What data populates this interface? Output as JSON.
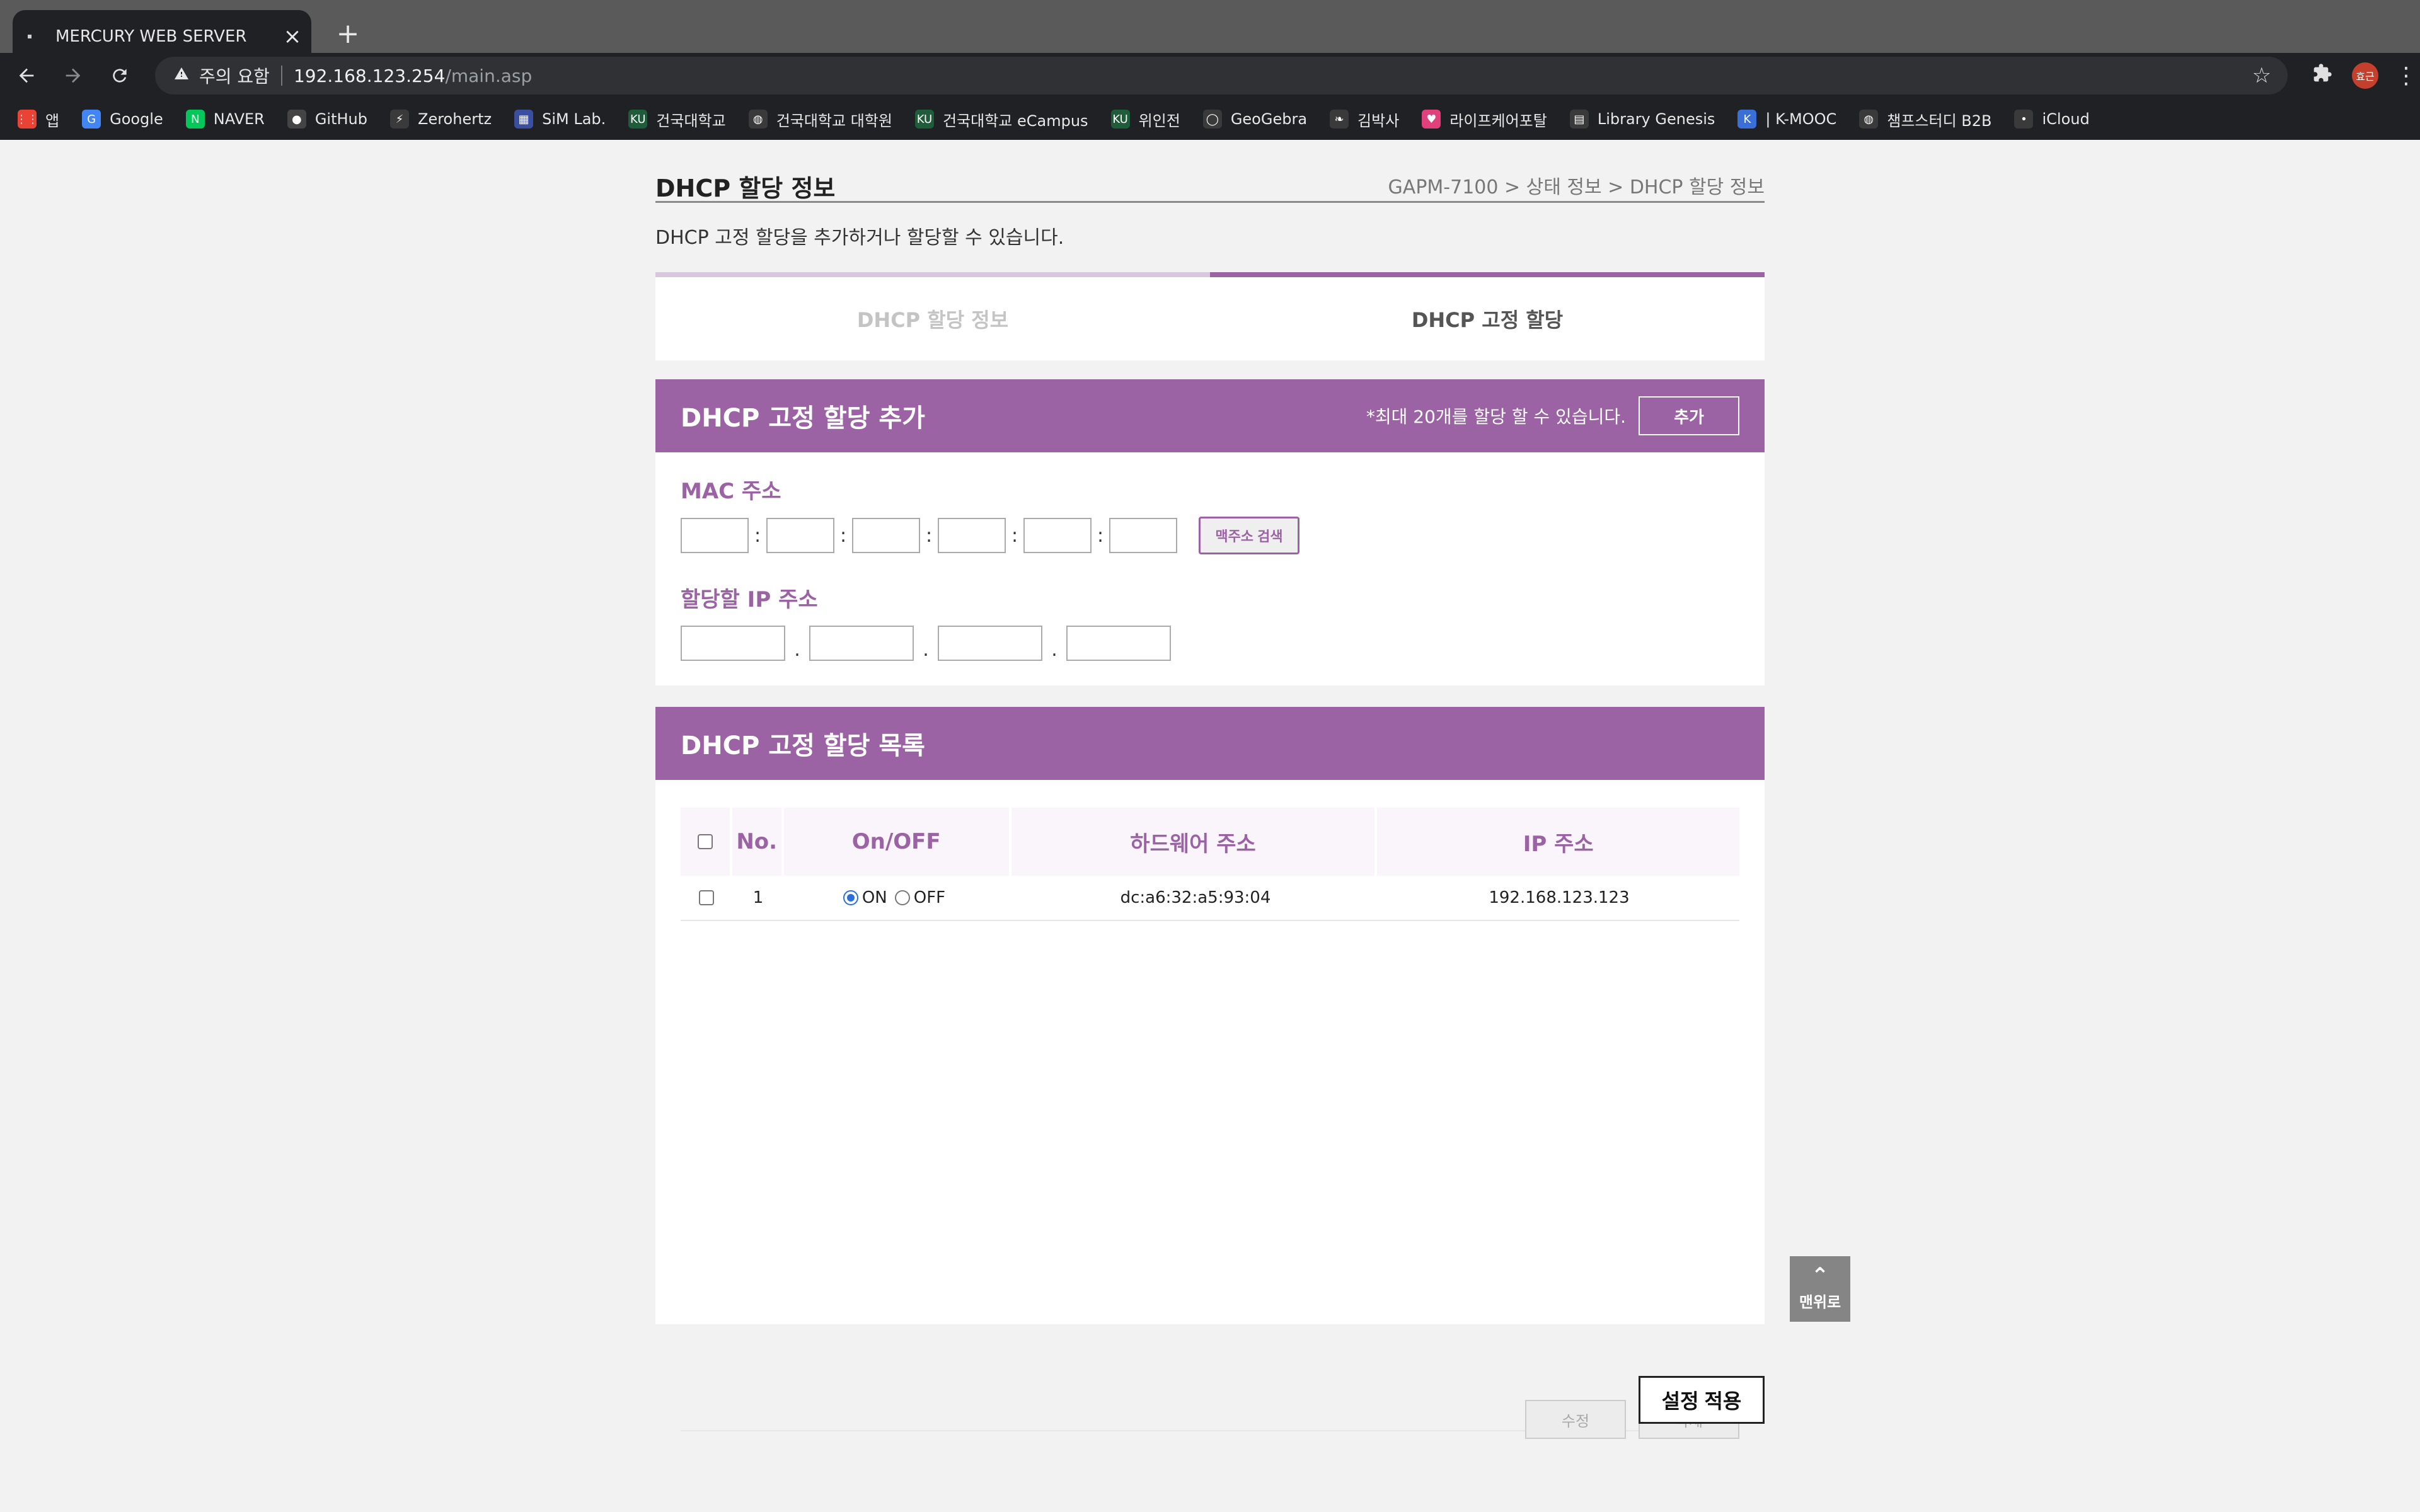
{
  "browser": {
    "tab_title": "MERCURY WEB SERVER",
    "tab_close": "×",
    "new_tab": "+",
    "security_label": "주의 요함",
    "url_host": "192.168.123.254",
    "url_path": "/main.asp",
    "avatar_text": "효근",
    "bookmarks": [
      {
        "label": "앱",
        "icon": "apps-grid-icon",
        "color": "#ea4335"
      },
      {
        "label": "Google",
        "icon": "google-icon",
        "color": "#4285f4"
      },
      {
        "label": "NAVER",
        "icon": "naver-icon",
        "color": "#03c75a"
      },
      {
        "label": "GitHub",
        "icon": "github-icon",
        "color": "#444444"
      },
      {
        "label": "Zerohertz",
        "icon": "bolt-icon",
        "color": "#3a3a3a"
      },
      {
        "label": "SiM Lab.",
        "icon": "simlab-icon",
        "color": "#3b4fa0"
      },
      {
        "label": "건국대학교",
        "icon": "ku-icon",
        "color": "#1f5c3a"
      },
      {
        "label": "건국대학교 대학원",
        "icon": "globe-icon",
        "color": "#3a3a3a"
      },
      {
        "label": "건국대학교 eCampus",
        "icon": "ku-icon",
        "color": "#1f5c3a"
      },
      {
        "label": "위인전",
        "icon": "ku-icon",
        "color": "#1f5c3a"
      },
      {
        "label": "GeoGebra",
        "icon": "geogebra-icon",
        "color": "#3a3a3a"
      },
      {
        "label": "김박사",
        "icon": "leaf-icon",
        "color": "#3a3a3a"
      },
      {
        "label": "라이프케어포탈",
        "icon": "heart-icon",
        "color": "#e0407c"
      },
      {
        "label": "Library Genesis",
        "icon": "book-icon",
        "color": "#3a3a3a"
      },
      {
        "label": "| K-MOOC",
        "icon": "kmooc-icon",
        "color": "#3b6fd8"
      },
      {
        "label": "챔프스터디 B2B",
        "icon": "globe-icon",
        "color": "#3a3a3a"
      },
      {
        "label": "iCloud",
        "icon": "apple-icon",
        "color": "#3a3a3a"
      }
    ]
  },
  "page": {
    "title": "DHCP 할당 정보",
    "breadcrumb": "GAPM-7100 > 상태 정보 > DHCP 할당 정보",
    "description": "DHCP 고정 할당을 추가하거나 할당할 수 있습니다.",
    "tabs": [
      {
        "label": "DHCP 할당 정보",
        "active": false
      },
      {
        "label": "DHCP 고정 할당",
        "active": true
      }
    ],
    "accent_color": "#9b63a4"
  },
  "add_section": {
    "title": "DHCP 고정 할당 추가",
    "note": "*최대 20개를 할당 할 수 있습니다.",
    "add_button": "추가",
    "mac_label": "MAC 주소",
    "mac_separator": ":",
    "mac_search_button": "맥주소 검색",
    "ip_label": "할당할 IP 주소",
    "ip_separator": "."
  },
  "list_section": {
    "title": "DHCP 고정 할당 목록",
    "columns": [
      "No.",
      "On/OFF",
      "하드웨어 주소",
      "IP 주소"
    ],
    "on_label": "ON",
    "off_label": "OFF",
    "rows": [
      {
        "no": "1",
        "state": "ON",
        "mac": "dc:a6:32:a5:93:04",
        "ip": "192.168.123.123"
      }
    ],
    "edit_button": "수정",
    "delete_button": "삭제"
  },
  "to_top_label": "맨위로",
  "apply_button": "설정 적용"
}
